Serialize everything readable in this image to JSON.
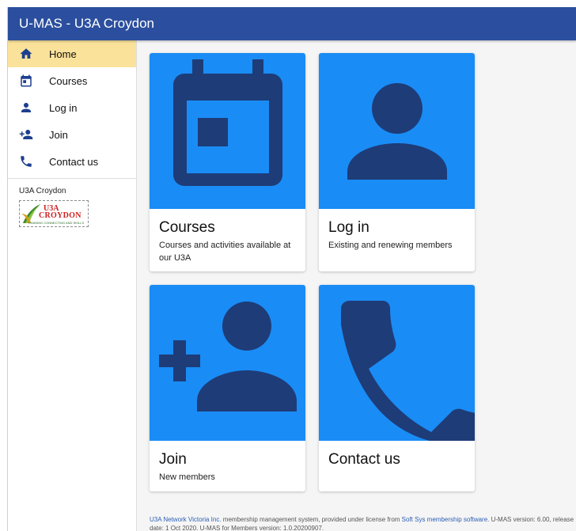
{
  "app": {
    "title": "U-MAS - U3A Croydon"
  },
  "sidebar": {
    "items": [
      {
        "label": "Home",
        "icon": "home-icon",
        "active": true
      },
      {
        "label": "Courses",
        "icon": "calendar-icon",
        "active": false
      },
      {
        "label": "Log in",
        "icon": "person-icon",
        "active": false
      },
      {
        "label": "Join",
        "icon": "person-add-icon",
        "active": false
      },
      {
        "label": "Contact us",
        "icon": "phone-icon",
        "active": false
      }
    ],
    "org_name": "U3A Croydon",
    "logo": {
      "line1": "U3A",
      "line2": "CROYDON",
      "tagline": "TRAINING CONNECTING AND SKILLS"
    }
  },
  "cards": [
    {
      "title": "Courses",
      "subtitle": "Courses and activities available at our U3A",
      "icon": "calendar-icon"
    },
    {
      "title": "Log in",
      "subtitle": "Existing and renewing members",
      "icon": "person-icon"
    },
    {
      "title": "Join",
      "subtitle": "New members",
      "icon": "person-add-icon"
    },
    {
      "title": "Contact us",
      "subtitle": "",
      "icon": "phone-icon"
    }
  ],
  "footer": {
    "network_link": "U3A Network Victoria Inc.",
    "text1": " membership management system, provided under license from ",
    "softsys_link": "Soft Sys membership software",
    "text2": ". U-MAS version: 6.00, release date: 1 Oct 2020. U-MAS for Members version: 1.0.20200907."
  },
  "colors": {
    "app_bar": "#2b4f9e",
    "active_nav": "#fbe29a",
    "card_media": "#1a8cf5",
    "card_icon": "#1e3c78",
    "nav_icon": "#1e3f8e"
  }
}
